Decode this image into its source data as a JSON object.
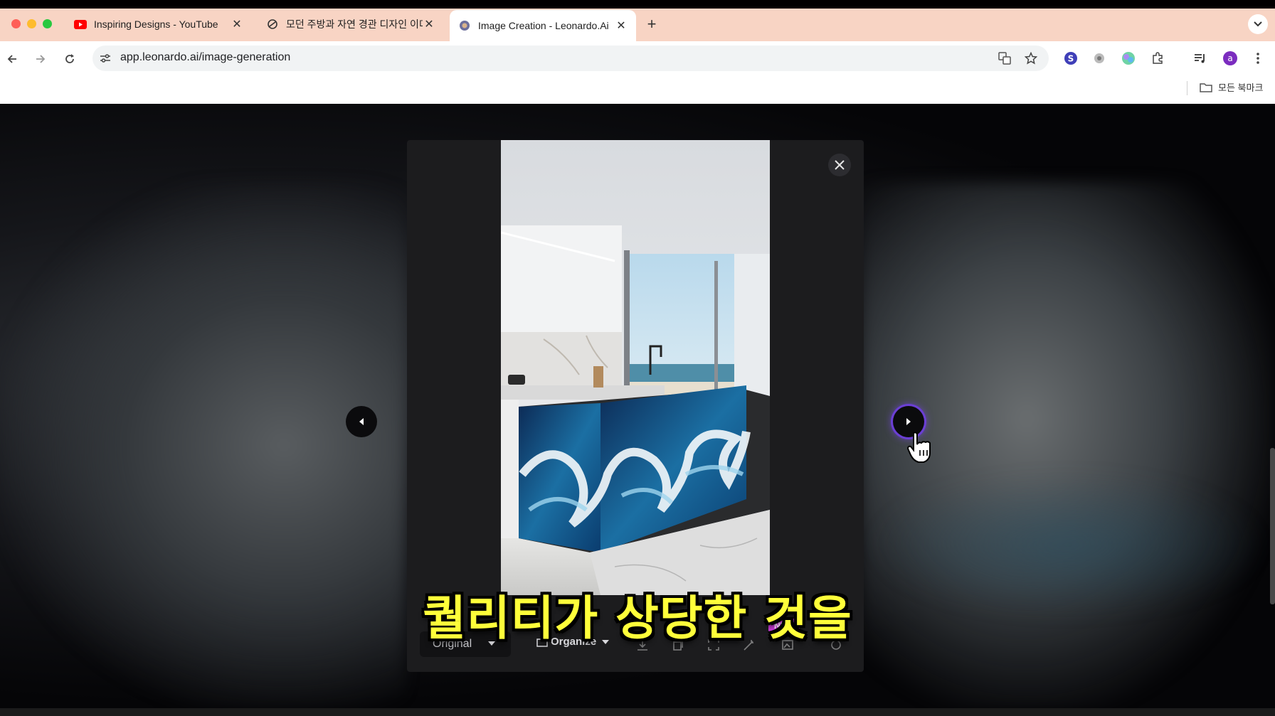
{
  "browser": {
    "tabs": [
      {
        "title": "Inspiring Designs - YouTube",
        "favicon": "youtube-icon",
        "active": false
      },
      {
        "title": "모던 주방과 자연 경관 디자인 이미",
        "favicon": "chatgpt-icon",
        "active": false
      },
      {
        "title": "Image Creation - Leonardo.Ai",
        "favicon": "leonardo-icon",
        "active": true
      }
    ],
    "new_tab": "+",
    "url": "app.leonardo.ai/image-generation",
    "bookmarks_all": "모든 북마크",
    "profile_initial": "a"
  },
  "viewer": {
    "image_description_icon": "kitchen-wave-island-image",
    "select_value": "Original",
    "organize_label": "Organize",
    "new_badge": "NEW"
  },
  "caption": {
    "text": "퀄리티가 상당한 것을"
  },
  "colors": {
    "tabbar": "#f8d4c4",
    "caption": "#ffff3a",
    "badge": "#c83ad6",
    "accent_ring": "#6b3fd4"
  }
}
